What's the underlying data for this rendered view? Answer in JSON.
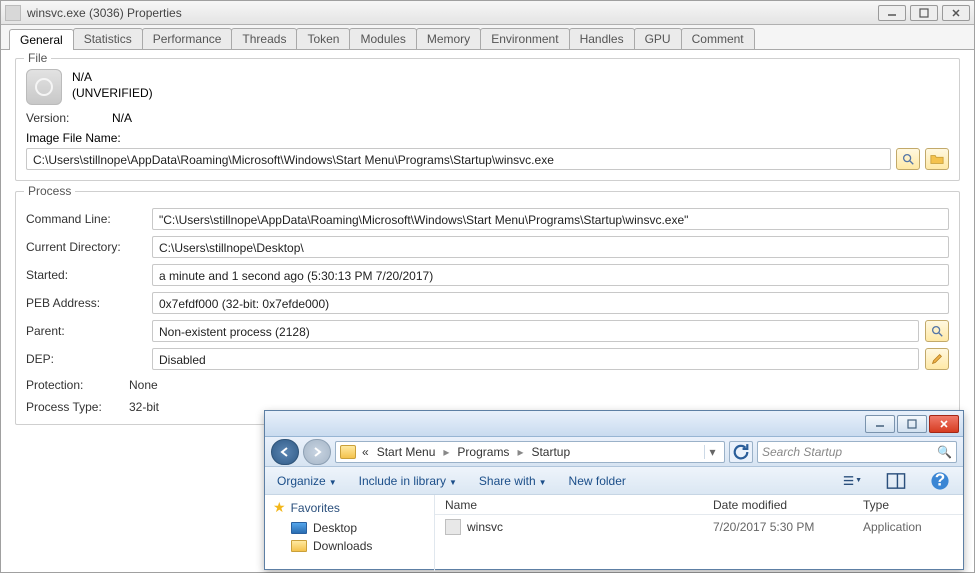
{
  "propwin": {
    "title": "winsvc.exe (3036) Properties",
    "tabs": [
      "General",
      "Statistics",
      "Performance",
      "Threads",
      "Token",
      "Modules",
      "Memory",
      "Environment",
      "Handles",
      "GPU",
      "Comment"
    ],
    "active_tab_index": 0,
    "file_group": {
      "legend": "File",
      "name_line": "N/A",
      "verified_line": "(UNVERIFIED)",
      "version_label": "Version:",
      "version_value": "N/A",
      "image_label": "Image File Name:",
      "image_value": "C:\\Users\\stillnope\\AppData\\Roaming\\Microsoft\\Windows\\Start Menu\\Programs\\Startup\\winsvc.exe"
    },
    "process_group": {
      "legend": "Process",
      "cmd_label": "Command Line:",
      "cmd_value": "\"C:\\Users\\stillnope\\AppData\\Roaming\\Microsoft\\Windows\\Start Menu\\Programs\\Startup\\winsvc.exe\"",
      "curdir_label": "Current Directory:",
      "curdir_value": "C:\\Users\\stillnope\\Desktop\\",
      "started_label": "Started:",
      "started_value": "a minute and 1 second ago (5:30:13 PM 7/20/2017)",
      "peb_label": "PEB Address:",
      "peb_value": "0x7efdf000 (32-bit: 0x7efde000)",
      "parent_label": "Parent:",
      "parent_value": "Non-existent process (2128)",
      "dep_label": "DEP:",
      "dep_value": "Disabled",
      "protection_label": "Protection:",
      "protection_value": "None",
      "ptype_label": "Process Type:",
      "ptype_value": "32-bit"
    }
  },
  "explorer": {
    "breadcrumb_lead": "«",
    "crumbs": [
      "Start Menu",
      "Programs",
      "Startup"
    ],
    "search_placeholder": "Search Startup",
    "toolbar": {
      "organize": "Organize",
      "include": "Include in library",
      "share": "Share with",
      "newfolder": "New folder"
    },
    "sidepane": {
      "favorites": "Favorites",
      "items": [
        "Desktop",
        "Downloads"
      ]
    },
    "columns": {
      "name": "Name",
      "date": "Date modified",
      "type": "Type"
    },
    "rows": [
      {
        "name": "winsvc",
        "date": "7/20/2017 5:30 PM",
        "type": "Application"
      }
    ]
  }
}
